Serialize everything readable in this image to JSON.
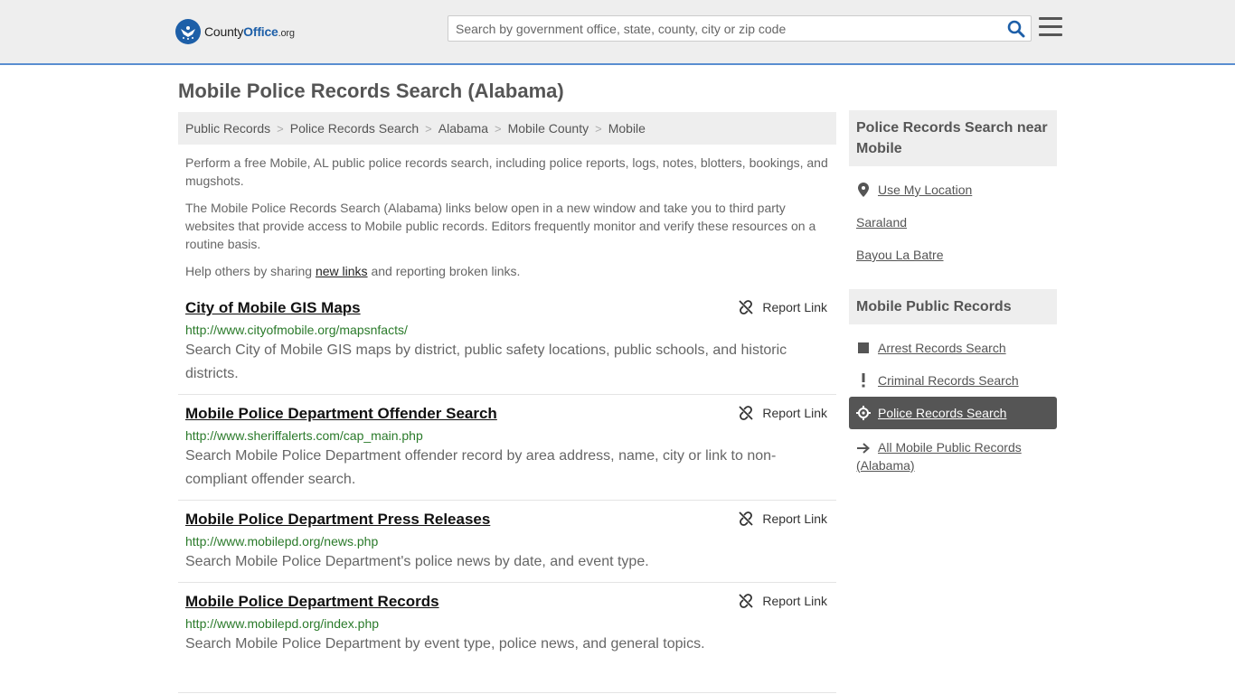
{
  "logo": {
    "prefix": "County",
    "brand": "Office",
    "tld": ".org"
  },
  "search": {
    "placeholder": "Search by government office, state, county, city or zip code"
  },
  "page_title": "Mobile Police Records Search (Alabama)",
  "breadcrumb": [
    "Public Records",
    "Police Records Search",
    "Alabama",
    "Mobile County",
    "Mobile"
  ],
  "intro": {
    "p1": "Perform a free Mobile, AL public police records search, including police reports, logs, notes, blotters, bookings, and mugshots.",
    "p2": "The Mobile Police Records Search (Alabama) links below open in a new window and take you to third party websites that provide access to Mobile public records. Editors frequently monitor and verify these resources on a routine basis.",
    "p3_pre": "Help others by sharing ",
    "p3_link": "new links",
    "p3_post": " and reporting broken links."
  },
  "report_label": "Report Link",
  "entries": [
    {
      "title": "City of Mobile GIS Maps",
      "url": "http://www.cityofmobile.org/mapsnfacts/",
      "desc": "Search City of Mobile GIS maps by district, public safety locations, public schools, and historic districts."
    },
    {
      "title": "Mobile Police Department Offender Search",
      "url": "http://www.sheriffalerts.com/cap_main.php",
      "desc": "Search Mobile Police Department offender record by area address, name, city or link to non-compliant offender search."
    },
    {
      "title": "Mobile Police Department Press Releases",
      "url": "http://www.mobilepd.org/news.php",
      "desc": "Search Mobile Police Department's police news by date, and event type."
    },
    {
      "title": "Mobile Police Department Records",
      "url": "http://www.mobilepd.org/index.php",
      "desc": "Search Mobile Police Department by event type, police news, and general topics."
    }
  ],
  "sidebar": {
    "near_title": "Police Records Search near Mobile",
    "near_links": [
      "Use My Location",
      "Saraland",
      "Bayou La Batre"
    ],
    "public_title": "Mobile Public Records",
    "public_links": [
      "Arrest Records Search",
      "Criminal Records Search",
      "Police Records Search",
      "All Mobile Public Records (Alabama)"
    ]
  },
  "colors": {
    "accent_blue": "#1d5fa8",
    "url_green": "#2a7a2a",
    "active_bg": "#555555"
  }
}
